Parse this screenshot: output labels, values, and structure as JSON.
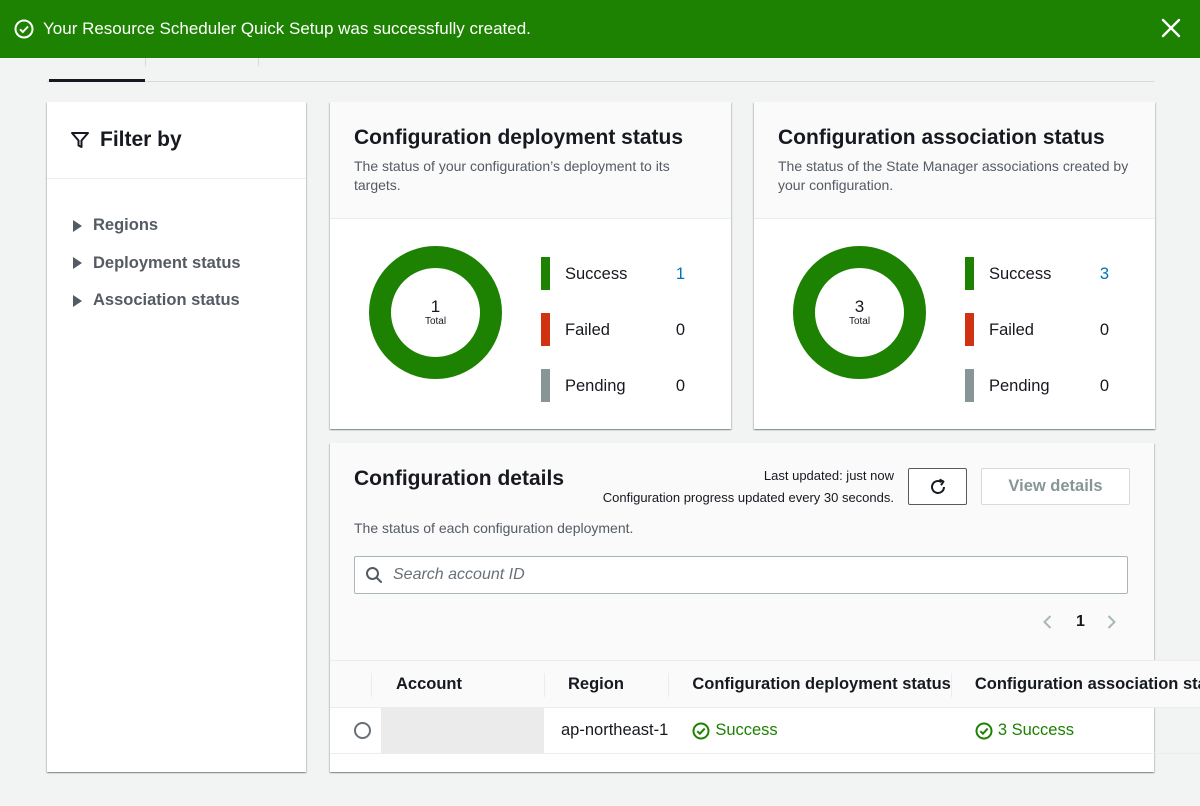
{
  "flash": {
    "message": "Your Resource Scheduler Quick Setup was successfully created."
  },
  "filter": {
    "title": "Filter by",
    "items": [
      {
        "label": "Regions"
      },
      {
        "label": "Deployment status"
      },
      {
        "label": "Association status"
      }
    ]
  },
  "deployment_status": {
    "title": "Configuration deployment status",
    "description": "The status of your configuration’s deployment to its targets.",
    "total": "1",
    "total_label": "Total",
    "legend": [
      {
        "label": "Success",
        "value": "1",
        "color": "#1d8102"
      },
      {
        "label": "Failed",
        "value": "0",
        "color": "#d13212"
      },
      {
        "label": "Pending",
        "value": "0",
        "color": "#879596"
      }
    ]
  },
  "association_status": {
    "title": "Configuration association status",
    "description": "The status of the State Manager associations created by your configuration.",
    "total": "3",
    "total_label": "Total",
    "legend": [
      {
        "label": "Success",
        "value": "3",
        "color": "#1d8102"
      },
      {
        "label": "Failed",
        "value": "0",
        "color": "#d13212"
      },
      {
        "label": "Pending",
        "value": "0",
        "color": "#879596"
      }
    ]
  },
  "details": {
    "title": "Configuration details",
    "last_updated": "Last updated: just now",
    "progress_note": "Configuration progress updated every 30 seconds.",
    "view_details_label": "View details",
    "subtitle": "The status of each configuration deployment.",
    "search_placeholder": "Search account ID",
    "page": "1",
    "columns": [
      "Account",
      "Region",
      "Configuration deployment status",
      "Configuration association status"
    ],
    "rows": [
      {
        "account": "",
        "region": "ap-northeast-1",
        "deployment_status": "Success",
        "association_status": "3 Success"
      }
    ]
  },
  "colors": {
    "success": "#1d8102",
    "failed": "#d13212",
    "pending": "#879596",
    "link": "#0073bb"
  }
}
